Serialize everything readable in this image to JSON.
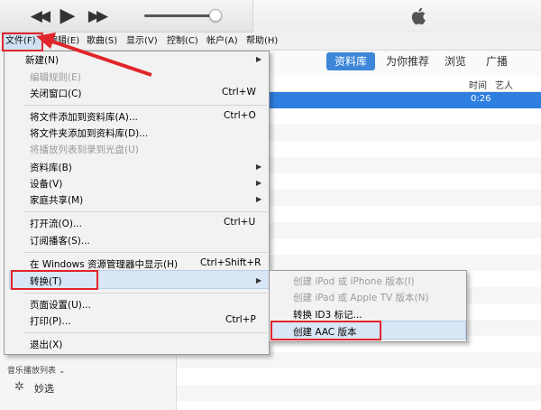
{
  "player": {
    "prev_glyph": "◀◀",
    "play_glyph": "▶",
    "next_glyph": "▶▶"
  },
  "menubar": {
    "file": "文件(F)",
    "edit": "编辑(E)",
    "song": "歌曲(S)",
    "view": "显示(V)",
    "controls": "控制(C)",
    "account": "帐户(A)",
    "help": "帮助(H)"
  },
  "tabs": {
    "library": "资料库",
    "for_you": "为你推荐",
    "browse": "浏览",
    "radio": "广播"
  },
  "columns": {
    "time": "时间",
    "artist": "艺人"
  },
  "selected_row": {
    "time": "0:26"
  },
  "sidebar": {
    "playlists_header": "音乐播放列表 ⌄",
    "genius_label": "妙选",
    "genius_icon": "✲"
  },
  "file_menu": {
    "new": "新建(N)",
    "edit_rules": "编辑规则(E)",
    "close_window": "关闭窗口(C)",
    "close_window_shortcut": "Ctrl+W",
    "add_file": "将文件添加到资料库(A)...",
    "add_file_shortcut": "Ctrl+O",
    "add_folder": "将文件夹添加到资料库(D)...",
    "burn_playlist": "将播放列表刻录到光盘(U)",
    "library": "资料库(B)",
    "devices": "设备(V)",
    "home_sharing": "家庭共享(M)",
    "open_stream": "打开流(O)...",
    "open_stream_shortcut": "Ctrl+U",
    "subscribe_podcast": "订阅播客(S)...",
    "show_in_explorer": "在 Windows 资源管理器中显示(H)",
    "show_in_explorer_shortcut": "Ctrl+Shift+R",
    "convert": "转换(T)",
    "page_setup": "页面设置(U)...",
    "print": "打印(P)...",
    "print_shortcut": "Ctrl+P",
    "exit": "退出(X)",
    "submenu_arrow": "▶"
  },
  "convert_submenu": {
    "ipod_iphone": "创建 iPod 或 iPhone 版本(I)",
    "ipad_appletv": "创建 iPad 或 Apple TV 版本(N)",
    "convert_id3": "转换 ID3 标记...",
    "create_aac": "创建 AAC 版本"
  },
  "colors": {
    "annotation_red": "#e0262b",
    "selection_blue": "#2f7fe0",
    "tab_active": "#3d86d8"
  }
}
